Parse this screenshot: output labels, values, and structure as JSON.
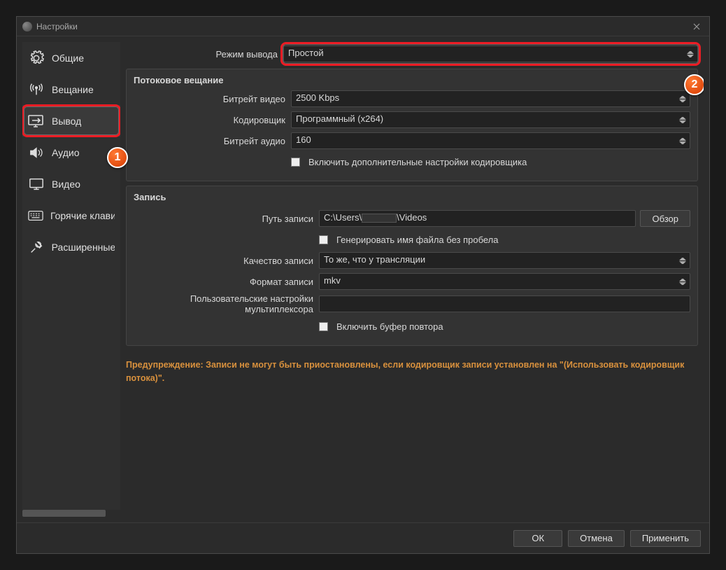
{
  "window": {
    "title": "Настройки"
  },
  "sidebar": {
    "items": [
      {
        "label": "Общие"
      },
      {
        "label": "Вещание"
      },
      {
        "label": "Вывод"
      },
      {
        "label": "Аудио"
      },
      {
        "label": "Видео"
      },
      {
        "label": "Горячие клавиши"
      },
      {
        "label": "Расширенные"
      }
    ]
  },
  "output_mode": {
    "label": "Режим вывода",
    "value": "Простой"
  },
  "streaming": {
    "title": "Потоковое вещание",
    "video_bitrate": {
      "label": "Битрейт видео",
      "value": "2500 Kbps"
    },
    "encoder": {
      "label": "Кодировщик",
      "value": "Программный (x264)"
    },
    "audio_bitrate": {
      "label": "Битрейт аудио",
      "value": "160"
    },
    "advanced": {
      "label": "Включить дополнительные настройки кодировщика"
    }
  },
  "recording": {
    "title": "Запись",
    "path": {
      "label": "Путь записи",
      "prefix": "C:\\Users\\",
      "suffix": "\\Videos"
    },
    "browse": "Обзор",
    "no_space": {
      "label": "Генерировать имя файла без пробела"
    },
    "quality": {
      "label": "Качество записи",
      "value": "То же, что у трансляции"
    },
    "format": {
      "label": "Формат записи",
      "value": "mkv"
    },
    "muxer": {
      "label": "Пользовательские настройки мультиплексора",
      "value": ""
    },
    "replay_buffer": {
      "label": "Включить буфер повтора"
    }
  },
  "warning": "Предупреждение: Записи не могут быть приостановлены, если кодировщик записи установлен на \"(Использовать кодировщик потока)\".",
  "footer": {
    "ok": "ОК",
    "cancel": "Отмена",
    "apply": "Применить"
  },
  "badge": {
    "one": "1",
    "two": "2"
  }
}
